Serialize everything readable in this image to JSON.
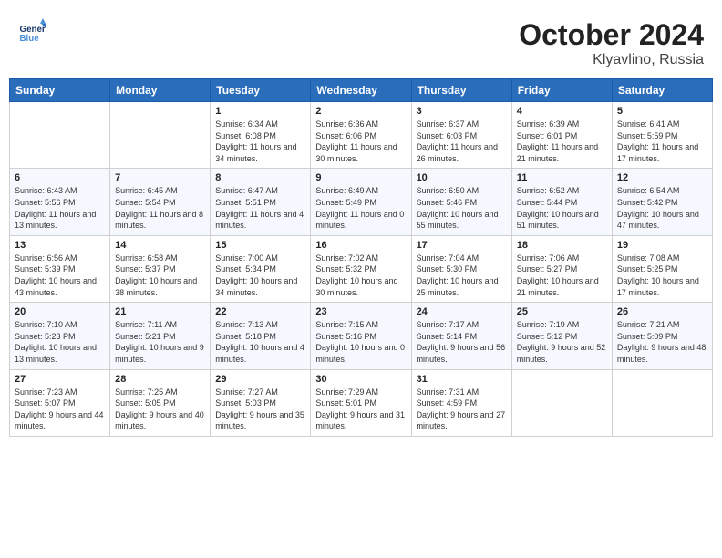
{
  "header": {
    "logo_line1": "General",
    "logo_line2": "Blue",
    "month_year": "October 2024",
    "location": "Klyavlino, Russia"
  },
  "weekdays": [
    "Sunday",
    "Monday",
    "Tuesday",
    "Wednesday",
    "Thursday",
    "Friday",
    "Saturday"
  ],
  "weeks": [
    [
      {
        "day": "",
        "content": ""
      },
      {
        "day": "",
        "content": ""
      },
      {
        "day": "1",
        "content": "Sunrise: 6:34 AM\nSunset: 6:08 PM\nDaylight: 11 hours and 34 minutes."
      },
      {
        "day": "2",
        "content": "Sunrise: 6:36 AM\nSunset: 6:06 PM\nDaylight: 11 hours and 30 minutes."
      },
      {
        "day": "3",
        "content": "Sunrise: 6:37 AM\nSunset: 6:03 PM\nDaylight: 11 hours and 26 minutes."
      },
      {
        "day": "4",
        "content": "Sunrise: 6:39 AM\nSunset: 6:01 PM\nDaylight: 11 hours and 21 minutes."
      },
      {
        "day": "5",
        "content": "Sunrise: 6:41 AM\nSunset: 5:59 PM\nDaylight: 11 hours and 17 minutes."
      }
    ],
    [
      {
        "day": "6",
        "content": "Sunrise: 6:43 AM\nSunset: 5:56 PM\nDaylight: 11 hours and 13 minutes."
      },
      {
        "day": "7",
        "content": "Sunrise: 6:45 AM\nSunset: 5:54 PM\nDaylight: 11 hours and 8 minutes."
      },
      {
        "day": "8",
        "content": "Sunrise: 6:47 AM\nSunset: 5:51 PM\nDaylight: 11 hours and 4 minutes."
      },
      {
        "day": "9",
        "content": "Sunrise: 6:49 AM\nSunset: 5:49 PM\nDaylight: 11 hours and 0 minutes."
      },
      {
        "day": "10",
        "content": "Sunrise: 6:50 AM\nSunset: 5:46 PM\nDaylight: 10 hours and 55 minutes."
      },
      {
        "day": "11",
        "content": "Sunrise: 6:52 AM\nSunset: 5:44 PM\nDaylight: 10 hours and 51 minutes."
      },
      {
        "day": "12",
        "content": "Sunrise: 6:54 AM\nSunset: 5:42 PM\nDaylight: 10 hours and 47 minutes."
      }
    ],
    [
      {
        "day": "13",
        "content": "Sunrise: 6:56 AM\nSunset: 5:39 PM\nDaylight: 10 hours and 43 minutes."
      },
      {
        "day": "14",
        "content": "Sunrise: 6:58 AM\nSunset: 5:37 PM\nDaylight: 10 hours and 38 minutes."
      },
      {
        "day": "15",
        "content": "Sunrise: 7:00 AM\nSunset: 5:34 PM\nDaylight: 10 hours and 34 minutes."
      },
      {
        "day": "16",
        "content": "Sunrise: 7:02 AM\nSunset: 5:32 PM\nDaylight: 10 hours and 30 minutes."
      },
      {
        "day": "17",
        "content": "Sunrise: 7:04 AM\nSunset: 5:30 PM\nDaylight: 10 hours and 25 minutes."
      },
      {
        "day": "18",
        "content": "Sunrise: 7:06 AM\nSunset: 5:27 PM\nDaylight: 10 hours and 21 minutes."
      },
      {
        "day": "19",
        "content": "Sunrise: 7:08 AM\nSunset: 5:25 PM\nDaylight: 10 hours and 17 minutes."
      }
    ],
    [
      {
        "day": "20",
        "content": "Sunrise: 7:10 AM\nSunset: 5:23 PM\nDaylight: 10 hours and 13 minutes."
      },
      {
        "day": "21",
        "content": "Sunrise: 7:11 AM\nSunset: 5:21 PM\nDaylight: 10 hours and 9 minutes."
      },
      {
        "day": "22",
        "content": "Sunrise: 7:13 AM\nSunset: 5:18 PM\nDaylight: 10 hours and 4 minutes."
      },
      {
        "day": "23",
        "content": "Sunrise: 7:15 AM\nSunset: 5:16 PM\nDaylight: 10 hours and 0 minutes."
      },
      {
        "day": "24",
        "content": "Sunrise: 7:17 AM\nSunset: 5:14 PM\nDaylight: 9 hours and 56 minutes."
      },
      {
        "day": "25",
        "content": "Sunrise: 7:19 AM\nSunset: 5:12 PM\nDaylight: 9 hours and 52 minutes."
      },
      {
        "day": "26",
        "content": "Sunrise: 7:21 AM\nSunset: 5:09 PM\nDaylight: 9 hours and 48 minutes."
      }
    ],
    [
      {
        "day": "27",
        "content": "Sunrise: 7:23 AM\nSunset: 5:07 PM\nDaylight: 9 hours and 44 minutes."
      },
      {
        "day": "28",
        "content": "Sunrise: 7:25 AM\nSunset: 5:05 PM\nDaylight: 9 hours and 40 minutes."
      },
      {
        "day": "29",
        "content": "Sunrise: 7:27 AM\nSunset: 5:03 PM\nDaylight: 9 hours and 35 minutes."
      },
      {
        "day": "30",
        "content": "Sunrise: 7:29 AM\nSunset: 5:01 PM\nDaylight: 9 hours and 31 minutes."
      },
      {
        "day": "31",
        "content": "Sunrise: 7:31 AM\nSunset: 4:59 PM\nDaylight: 9 hours and 27 minutes."
      },
      {
        "day": "",
        "content": ""
      },
      {
        "day": "",
        "content": ""
      }
    ]
  ]
}
